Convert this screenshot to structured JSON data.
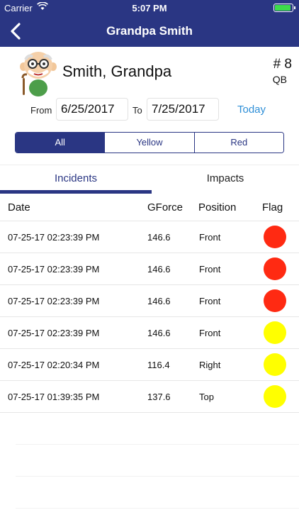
{
  "status_bar": {
    "carrier": "Carrier",
    "time": "5:07 PM",
    "battery_color": "#3ddc4b"
  },
  "nav": {
    "title": "Grandpa Smith",
    "back_icon": "chevron-left-icon",
    "background": "#2a3683"
  },
  "profile": {
    "name": "Smith, Grandpa",
    "jersey": "# 8",
    "position": "QB",
    "avatar_icon": "grandpa-avatar"
  },
  "date_range": {
    "from_label": "From",
    "from_value": "6/25/2017",
    "to_label": "To",
    "to_value": "7/25/2017",
    "today_label": "Today"
  },
  "filter": {
    "options": [
      "All",
      "Yellow",
      "Red"
    ],
    "selected": "All"
  },
  "tabs": {
    "incidents": "Incidents",
    "impacts": "Impacts",
    "active": "Incidents"
  },
  "table": {
    "headers": {
      "date": "Date",
      "gforce": "GForce",
      "position": "Position",
      "flag": "Flag"
    },
    "rows": [
      {
        "date": "07-25-17 02:23:39 PM",
        "gforce": "146.6",
        "position": "Front",
        "flag": "red"
      },
      {
        "date": "07-25-17 02:23:39 PM",
        "gforce": "146.6",
        "position": "Front",
        "flag": "red"
      },
      {
        "date": "07-25-17 02:23:39 PM",
        "gforce": "146.6",
        "position": "Front",
        "flag": "red"
      },
      {
        "date": "07-25-17 02:23:39 PM",
        "gforce": "146.6",
        "position": "Front",
        "flag": "yellow"
      },
      {
        "date": "07-25-17 02:20:34 PM",
        "gforce": "116.4",
        "position": "Right",
        "flag": "yellow"
      },
      {
        "date": "07-25-17 01:39:35 PM",
        "gforce": "137.6",
        "position": "Top",
        "flag": "yellow"
      }
    ]
  },
  "colors": {
    "red": "#ff2a12",
    "yellow": "#ffff00",
    "accent": "#2a3683",
    "link": "#2f8fd7"
  }
}
